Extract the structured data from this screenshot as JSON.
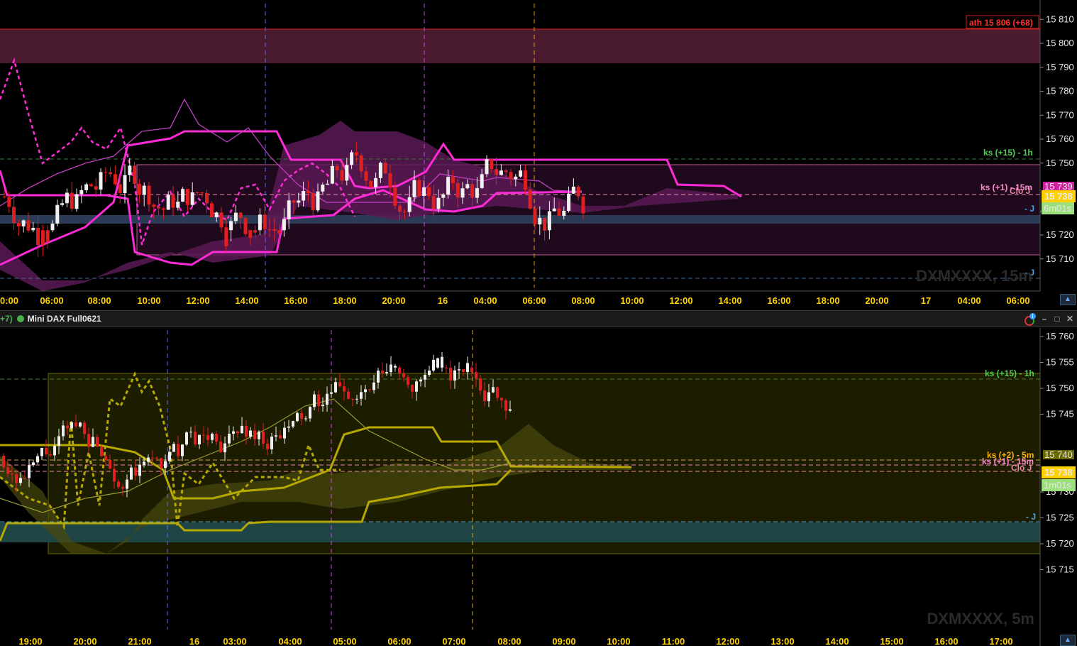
{
  "top": {
    "instrument_watermark": "DXMXXXX, 15m",
    "price_labels": [
      "15 810",
      "15 800",
      "15 790",
      "15 780",
      "15 770",
      "15 760",
      "15 750",
      "15 730",
      "15 720",
      "15 710"
    ],
    "price_values": [
      15810,
      15800,
      15790,
      15780,
      15770,
      15760,
      15750,
      15730,
      15720,
      15710
    ],
    "time_labels": [
      "0:00",
      "06:00",
      "08:00",
      "10:00",
      "12:00",
      "14:00",
      "16:00",
      "18:00",
      "20:00",
      "16",
      "04:00",
      "06:00",
      "08:00",
      "10:00",
      "12:00",
      "14:00",
      "16:00",
      "18:00",
      "20:00",
      "17",
      "04:00",
      "06:00"
    ],
    "ath_label": "ath 15 806 (+68)",
    "ks_1h_label": "ks (+15) - 1h",
    "ks_15m_label": "ks (+1) - 15m",
    "clo_label": "Clo J",
    "j_label": "- J",
    "j_label_low": "- J",
    "current_price": "15 738",
    "timer": "6m01s",
    "ghost_price": "15 739",
    "colors": {
      "accent": "#ff2bd6",
      "cloud": "#5a1a55",
      "ath_band": "#4a1a2e",
      "j_band": "#2b3a55"
    }
  },
  "separator": {
    "prefix": "+7)",
    "title": "Mini DAX Full0621"
  },
  "bottom": {
    "instrument_watermark": "DXMXXXX, 5m",
    "price_labels": [
      "15 760",
      "15 755",
      "15 750",
      "15 745",
      "15 730",
      "15 725",
      "15 720",
      "15 715"
    ],
    "price_values": [
      15760,
      15755,
      15750,
      15745,
      15730,
      15725,
      15720,
      15715
    ],
    "time_labels": [
      "19:00",
      "20:00",
      "21:00",
      "16",
      "03:00",
      "04:00",
      "05:00",
      "06:00",
      "07:00",
      "08:00",
      "09:00",
      "10:00",
      "11:00",
      "12:00",
      "13:00",
      "14:00",
      "15:00",
      "16:00",
      "17:00"
    ],
    "ks_1h_label": "ks (+15) - 1h",
    "ks_5m_label": "ks (+2) - 5m",
    "ks_15m_label": "ks (+1) - 15m",
    "clo_label": "Clo J",
    "j_label": "- J",
    "current_price": "15 738",
    "timer": "1m01s",
    "ghost_price": "15 740",
    "colors": {
      "accent": "#b5a800",
      "cloud": "#3a3a00",
      "j_band": "#1f4545"
    }
  }
}
